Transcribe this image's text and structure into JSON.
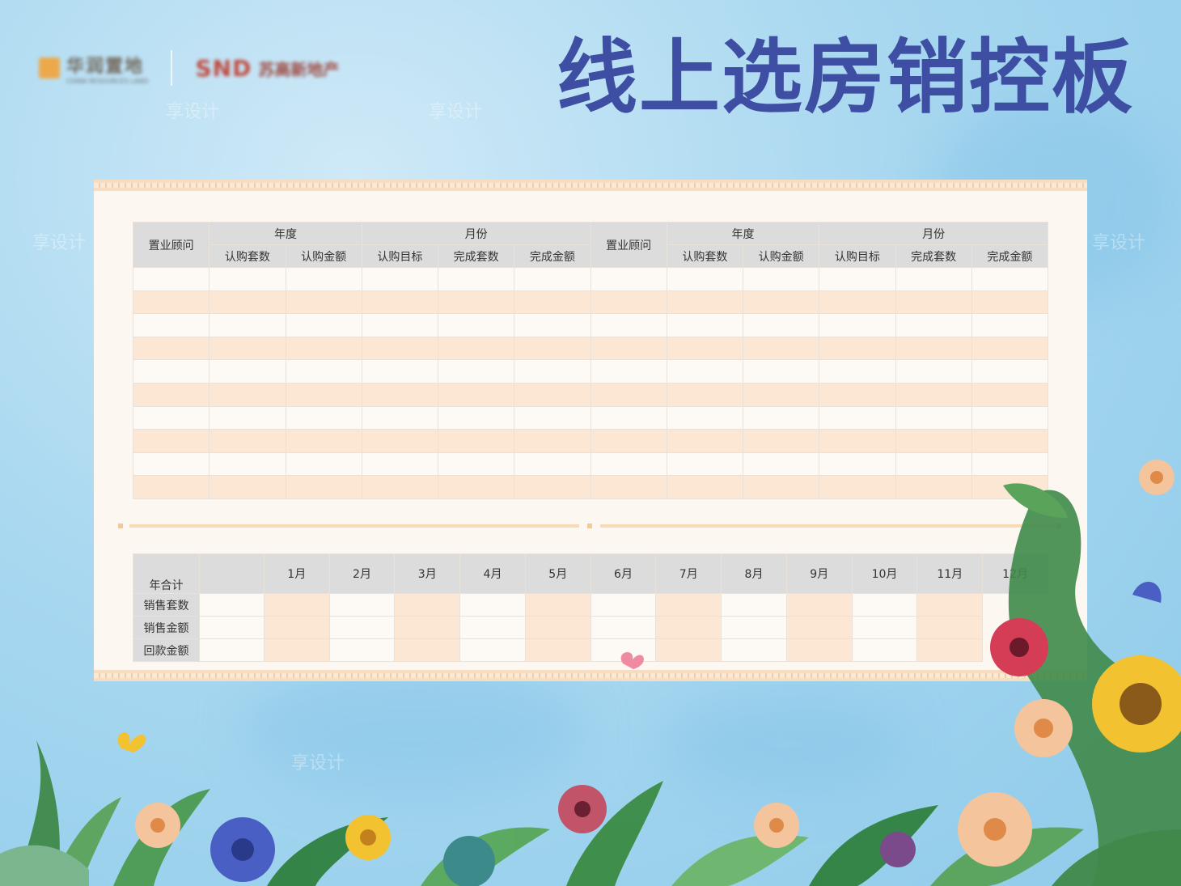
{
  "header": {
    "title": "线上选房销控板",
    "logo1_text": "华润置地",
    "logo1_sub": "CHINA RESOURCES LAND",
    "logo2_text": "SND",
    "logo2_cn": "苏高新地产"
  },
  "table_top": {
    "advisor_label": "置业顾问",
    "year_label": "年度",
    "month_label": "月份",
    "sub_headers": [
      "认购套数",
      "认购金额",
      "认购目标",
      "完成套数",
      "完成金额"
    ],
    "row_count": 10
  },
  "table_bottom": {
    "row_header": "年合计",
    "months": [
      "1月",
      "2月",
      "3月",
      "4月",
      "5月",
      "6月",
      "7月",
      "8月",
      "9月",
      "10月",
      "11月",
      "12月"
    ],
    "rows": [
      "销售套数",
      "销售金额",
      "回款金额"
    ]
  },
  "watermark": "享设计",
  "colors": {
    "title": "#3d4ea3",
    "panel": "#fdf7f1",
    "header_cell": "#dcdcdc",
    "stripe": "#fbe7d3"
  }
}
